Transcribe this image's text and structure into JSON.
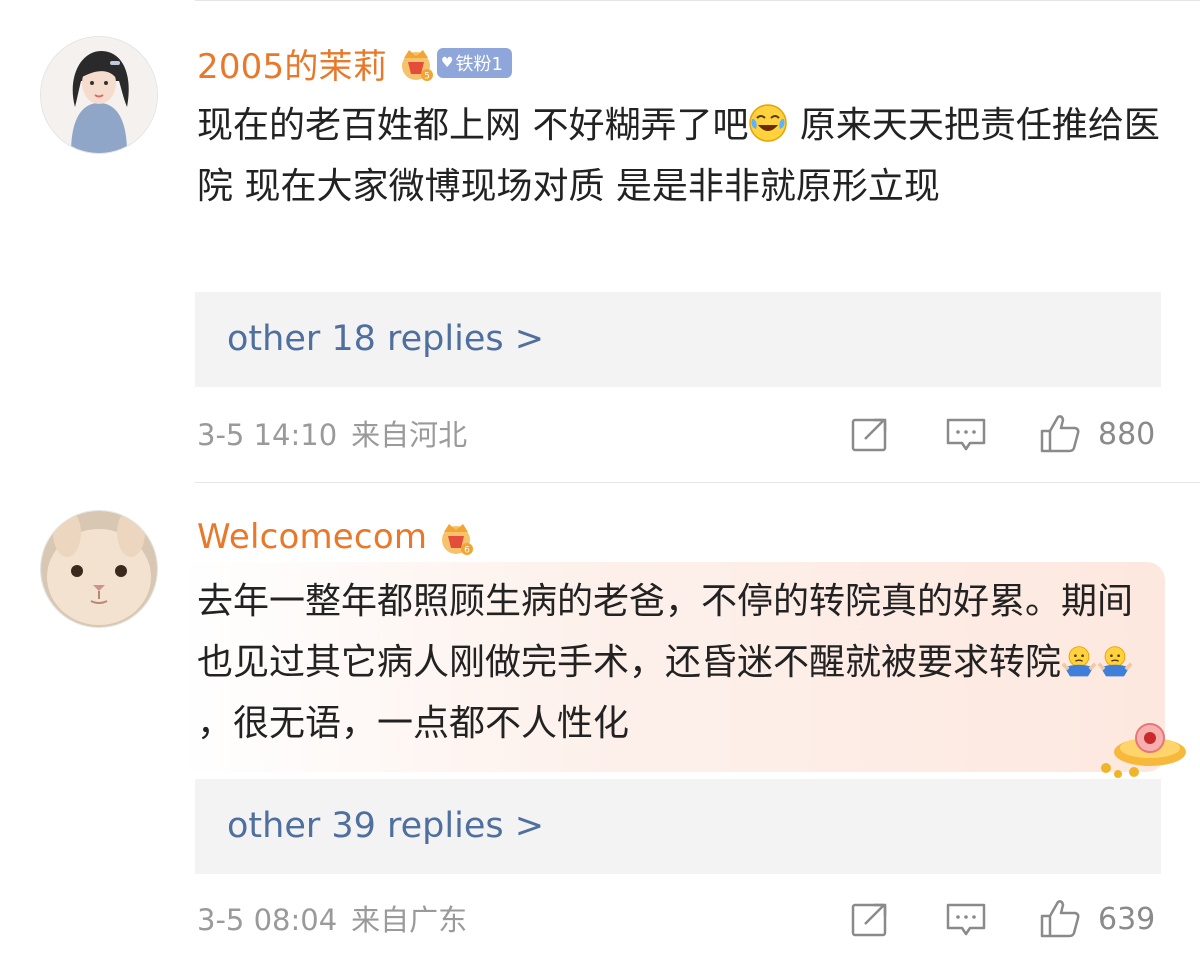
{
  "comments": [
    {
      "username": "2005的茉莉",
      "fan_badge": "铁粉1",
      "content_parts": [
        "现在的老百姓都上网  不好糊弄了吧",
        "  原来天天把责任推给医院  现在大家微博现场对质  是是非非就原形立现"
      ],
      "emoji_1": "laughing-crying-emoji",
      "replies": "other 18 replies >",
      "time": "3-5 14:10",
      "location": "来自河北",
      "likes": "880",
      "icons": [
        "repost-icon",
        "comment-icon",
        "like-icon"
      ]
    },
    {
      "username": "Welcomecom",
      "content_parts": [
        "去年一整年都照顾生病的老爸，不停的转院真的好累。期间也见过其它病人刚做完手术，还昏迷不醒就被要求转院",
        "，很无语，一点都不人性化"
      ],
      "emoji_1": "shrug-emoji",
      "replies": "other 39 replies >",
      "time": "3-5 08:04",
      "location": "来自广东",
      "likes": "639",
      "icons": [
        "repost-icon",
        "comment-icon",
        "like-icon"
      ]
    }
  ],
  "colors": {
    "username": "#e8782a",
    "link": "#4f6f9f",
    "meta": "#9a9a9a",
    "badge": "#8ea6d9"
  }
}
